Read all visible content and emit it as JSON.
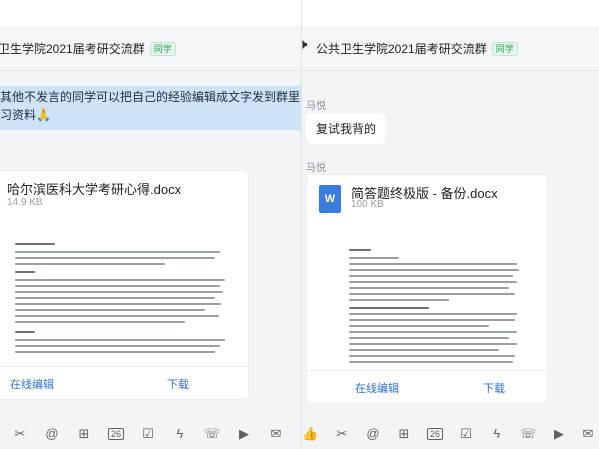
{
  "left": {
    "title": "卫生学院2021届考研交流群",
    "group_tag": "同学",
    "notice_line1": "其他不发言的同学可以把自己的经验编辑成文字发到群里  还",
    "notice_line2": "习资料🙏",
    "file": {
      "name": "哈尔滨医科大学考研心得.docx",
      "size": "14.9 KB",
      "online_edit": "在线编辑",
      "download": "下载"
    }
  },
  "right": {
    "title": "公共卫生学院2021届考研交流群",
    "group_tag": "同学",
    "sender1": "马悦",
    "message1": "复试我背的",
    "sender2": "马悦",
    "file": {
      "icon_letter": "W",
      "name": "简答题终极版 - 备份.docx",
      "size": "100 KB",
      "online_edit": "在线编辑",
      "download": "下载"
    }
  },
  "toolbar_icons": [
    "scissors-icon",
    "at-icon",
    "add-file-icon",
    "calendar-26-icon",
    "checkbox-icon",
    "lightning-icon",
    "phone-icon",
    "video-icon",
    "mail-icon",
    "more-icon"
  ]
}
